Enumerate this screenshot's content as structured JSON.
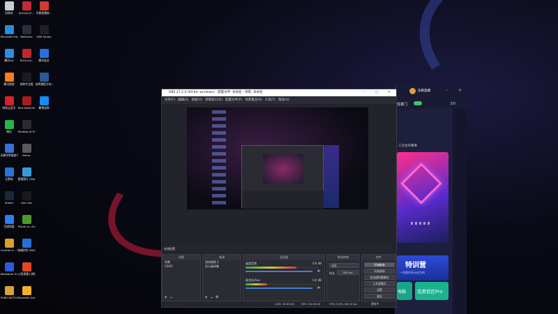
{
  "desktop": {
    "icons": [
      {
        "label": "回收站",
        "icon": "recycle-bin-icon",
        "color": "#c7ccd6"
      },
      {
        "label": "ArmouryC...",
        "icon": "armoury-icon",
        "color": "#c42a35"
      },
      {
        "label": "乐教直播软...",
        "icon": "app-icon",
        "color": "#d43a2f"
      },
      {
        "label": "Microsoft Edge",
        "icon": "edge-icon",
        "color": "#2b8cd8"
      },
      {
        "label": "WeGame",
        "icon": "wegame-icon",
        "color": "#2a2e3c"
      },
      {
        "label": "OBS Studio",
        "icon": "obs-icon",
        "color": "#1f1f23"
      },
      {
        "label": "腾讯QQ",
        "icon": "qq-icon",
        "color": "#2d8fe3"
      },
      {
        "label": "ROGLive..",
        "icon": "rog-icon",
        "color": "#c1272d"
      },
      {
        "label": "腾讯会议",
        "icon": "meeting-icon",
        "color": "#2a6fe0"
      },
      {
        "label": "腾讯视频",
        "icon": "tencent-video-icon",
        "color": "#ff7a1a"
      },
      {
        "label": "剪映专业版",
        "icon": "jianying-icon",
        "color": "#1c1c1c"
      },
      {
        "label": "忠辉课程主持.docx",
        "icon": "doc-icon",
        "color": "#2b579a"
      },
      {
        "label": "网易云音乐",
        "icon": "netease-music-icon",
        "color": "#d6242b"
      },
      {
        "label": "Red Dead Redempti...",
        "icon": "rdr-icon",
        "color": "#a51e1e"
      },
      {
        "label": "暴雪战网",
        "icon": "battlenet-icon",
        "color": "#148eff"
      },
      {
        "label": "微信",
        "icon": "wechat-icon",
        "color": "#2bb24c"
      },
      {
        "label": "Shadow of the Tom...",
        "icon": "tomb-raider-icon",
        "color": "#2b2b2b"
      },
      {
        "label": "",
        "icon": "",
        "color": ""
      },
      {
        "label": "风暴世界服助手平台",
        "icon": "app-icon",
        "color": "#3c6fd1"
      },
      {
        "label": "Mirror",
        "icon": "mirror-icon",
        "color": "#5a5a5a"
      },
      {
        "label": "",
        "icon": "",
        "color": ""
      },
      {
        "label": "企鹅电",
        "icon": "app-icon",
        "color": "#2a72d6"
      },
      {
        "label": "看看图片 (Mahjong...",
        "icon": "app-icon",
        "color": "#3a9ad9"
      },
      {
        "label": "",
        "icon": "",
        "color": ""
      },
      {
        "label": "Steam",
        "icon": "steam-icon",
        "color": "#1b2838"
      },
      {
        "label": "Aim Lab",
        "icon": "aimlab-icon",
        "color": "#1a1a1a"
      },
      {
        "label": "",
        "icon": "",
        "color": ""
      },
      {
        "label": "百度网盘",
        "icon": "baidu-netdisk-icon",
        "color": "#2f7bf0"
      },
      {
        "label": "Plants vs. Zombie...",
        "icon": "pvz-icon",
        "color": "#4c9a2a"
      },
      {
        "label": "",
        "icon": "",
        "color": ""
      },
      {
        "label": "Counter-S... Global Off...",
        "icon": "csgo-icon",
        "color": "#d9a12a"
      },
      {
        "label": "穿越时空 WeGame版",
        "icon": "app-icon",
        "color": "#2b6fd6"
      },
      {
        "label": "",
        "icon": "",
        "color": ""
      },
      {
        "label": "Wallpaper Engine: ...",
        "icon": "wallpaper-engine-icon",
        "color": "#2a5bd6"
      },
      {
        "label": "斗鱼直播工具助手...",
        "icon": "app-icon",
        "color": "#e0462a"
      },
      {
        "label": "",
        "icon": "",
        "color": ""
      },
      {
        "label": "PUBG BATTLEGR...",
        "icon": "pubg-icon",
        "color": "#d6a33a"
      },
      {
        "label": "Rockstar Games...",
        "icon": "rockstar-icon",
        "color": "#f2b12a"
      },
      {
        "label": "",
        "icon": "",
        "color": ""
      }
    ]
  },
  "obs": {
    "title": "OBS 27.2.4 (64-bit, windows) - 配置文件: 未命名 - 场景: 未命名",
    "menu": [
      "文件(F)",
      "编辑(E)",
      "视图(V)",
      "停靠窗口(D)",
      "配置文件(P)",
      "场景集合(S)",
      "工具(T)",
      "帮助(H)"
    ],
    "scene_panel_title": "来源配置",
    "scenes_header": "场景",
    "scenes": [
      "场景",
      "CSGO"
    ],
    "sources_header": "来源",
    "sources": [
      "游戏捕获 2",
      "显示器采集"
    ],
    "mixer_header": "混音器",
    "mixer_tracks": [
      {
        "name": "桌面音频",
        "db": "0.0 dB",
        "level": 0.7
      },
      {
        "name": "麦克风/Aux",
        "db": "0.0 dB",
        "level": 0.3
      }
    ],
    "transitions_header": "转场特效",
    "transition_value": "淡出",
    "duration_label": "时长",
    "duration_value": "300 ms",
    "controls_header": "控件",
    "controls": [
      "开始推流",
      "开始录制",
      "启动虚拟摄像机",
      "工作室模式",
      "设置",
      "退出"
    ],
    "status": {
      "live": "LIVE: 00:00:00",
      "rec": "REC: 00:00:00",
      "cpu": "CPU: 5.0%, 60.00 fps",
      "misc": "更新中"
    }
  },
  "right_app": {
    "header_text": "乐教直播",
    "numbers": "3/0",
    "tag1": "任意门",
    "text1": "三次合作赛事",
    "banner_title": "特训营",
    "banner_sub": "一次报名多元化方向",
    "button_left": "电脑",
    "button_right": "完美官匹Pro"
  },
  "colors": {
    "accent": "#3d5ff0",
    "obs_bg": "#22232b",
    "title_bg": "#ffffff",
    "right_bg": "#1d1f3d"
  }
}
